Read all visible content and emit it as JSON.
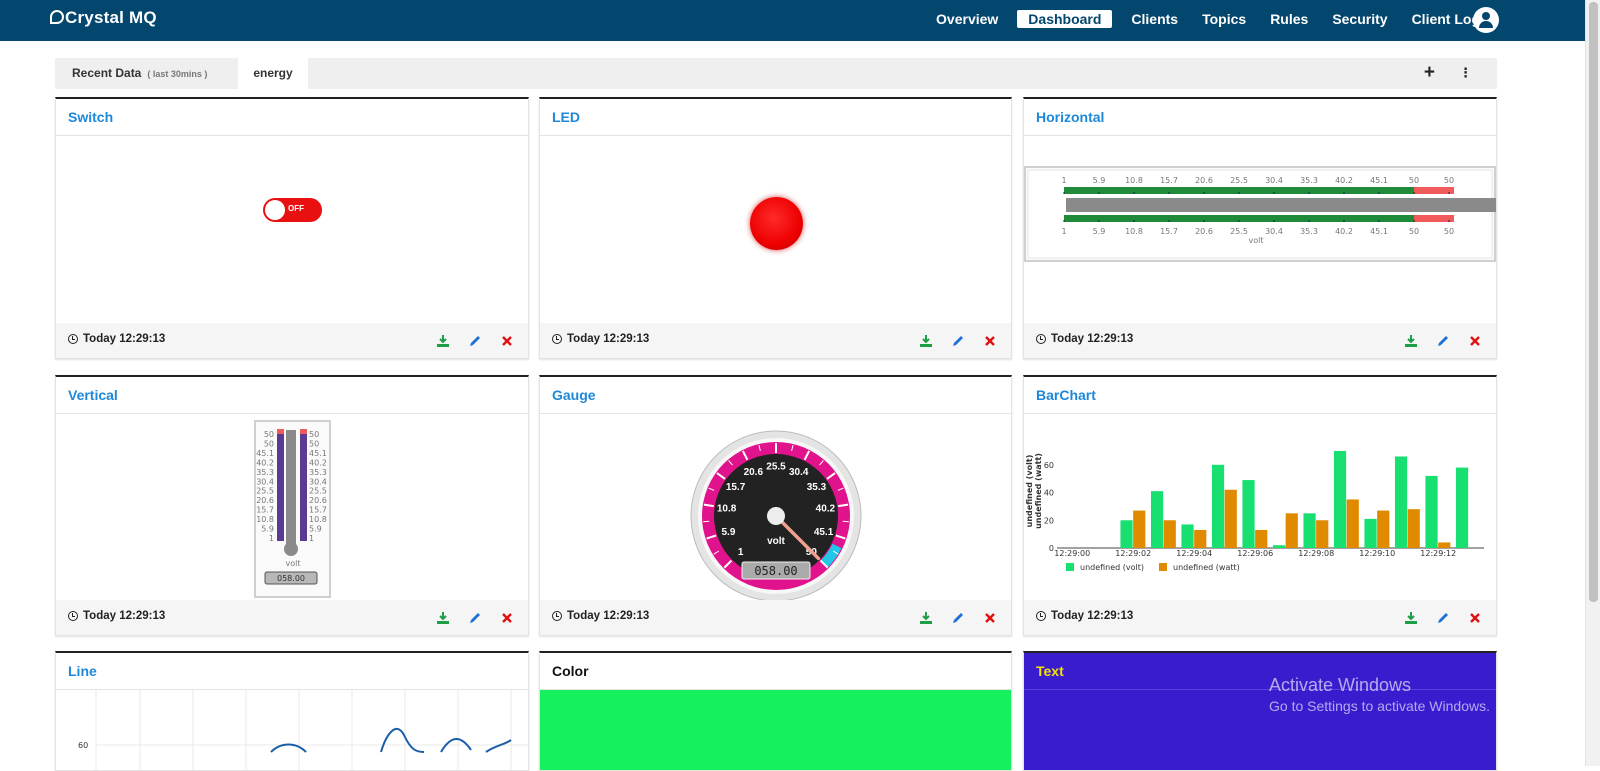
{
  "app": {
    "name": "Crystal MQ",
    "logo_mark": "C"
  },
  "nav": [
    {
      "label": "Overview"
    },
    {
      "label": "Dashboard",
      "active": true
    },
    {
      "label": "Clients"
    },
    {
      "label": "Topics"
    },
    {
      "label": "Rules"
    },
    {
      "label": "Security"
    },
    {
      "label": "Client Log"
    }
  ],
  "tabs": {
    "recent": "Recent Data",
    "recent_sub": "( last 30mins )",
    "energy": "energy",
    "add_icon": "plus-icon",
    "more_icon": "more-vertical-icon"
  },
  "timestamp": "Today 12:29:13",
  "colors": {
    "accent": "#1e88d8",
    "topbar": "#03466e",
    "download": "#1e9e45",
    "edit": "#1e6fd8",
    "delete": "#e01010",
    "switch_off": "#e81010",
    "led_off": "#ff0000",
    "bar_volt": "#18e070",
    "bar_watt": "#e08a00",
    "color_widget": "#14f05e",
    "text_widget": "#3a1ccf",
    "text_widget_title": "#f5e000"
  },
  "widgets": {
    "switch": {
      "title": "Switch",
      "state": "OFF"
    },
    "led": {
      "title": "LED",
      "state": "off"
    },
    "horizontal": {
      "title": "Horizontal",
      "ticks": [
        "1",
        "5.9",
        "10.8",
        "15.7",
        "20.6",
        "25.5",
        "30.4",
        "35.3",
        "40.2",
        "45.1",
        "50",
        "50"
      ],
      "unit": "volt"
    },
    "vertical": {
      "title": "Vertical",
      "ticks": [
        "50",
        "50",
        "45.1",
        "40.2",
        "35.3",
        "30.4",
        "25.5",
        "20.6",
        "15.7",
        "10.8",
        "5.9",
        "1"
      ],
      "unit": "volt",
      "readout": "058.00"
    },
    "gauge": {
      "title": "Gauge",
      "ticks": [
        "1",
        "5.9",
        "10.8",
        "15.7",
        "20.6",
        "25.5",
        "30.4",
        "35.3",
        "40.2",
        "45.1",
        "50"
      ],
      "unit": "volt",
      "readout": "058.00"
    },
    "barchart": {
      "title": "BarChart"
    },
    "line": {
      "title": "Line",
      "y_tick": "60"
    },
    "color": {
      "title": "Color"
    },
    "text": {
      "title": "Text"
    }
  },
  "chart_data": {
    "type": "bar",
    "categories": [
      "12:29:00",
      "12:29:01",
      "12:29:02",
      "12:29:03",
      "12:29:04",
      "12:29:05",
      "12:29:06",
      "12:29:07",
      "12:29:08",
      "12:29:09",
      "12:29:10",
      "12:29:11",
      "12:29:12",
      "12:29:13"
    ],
    "x_tick_labels": [
      "12:29:00",
      "12:29:02",
      "12:29:04",
      "12:29:06",
      "12:29:08",
      "12:29:10",
      "12:29:12"
    ],
    "series": [
      {
        "name": "undefined (volt)",
        "color": "#18e070",
        "values": [
          0,
          0,
          20,
          41,
          17,
          60,
          49,
          2,
          25,
          70,
          21,
          66,
          52,
          58
        ]
      },
      {
        "name": "undefined (watt)",
        "color": "#e08a00",
        "values": [
          0,
          0,
          27,
          20,
          13,
          42,
          13,
          25,
          20,
          35,
          27,
          28,
          4,
          0
        ]
      }
    ],
    "ylabel": "undefined (volt)",
    "ylabel2": "undefined (watt)",
    "y_ticks": [
      0,
      20,
      40,
      60
    ],
    "ylim": [
      0,
      75
    ],
    "legend": "bottom"
  },
  "watermark": {
    "line1": "Activate Windows",
    "line2": "Go to Settings to activate Windows."
  }
}
